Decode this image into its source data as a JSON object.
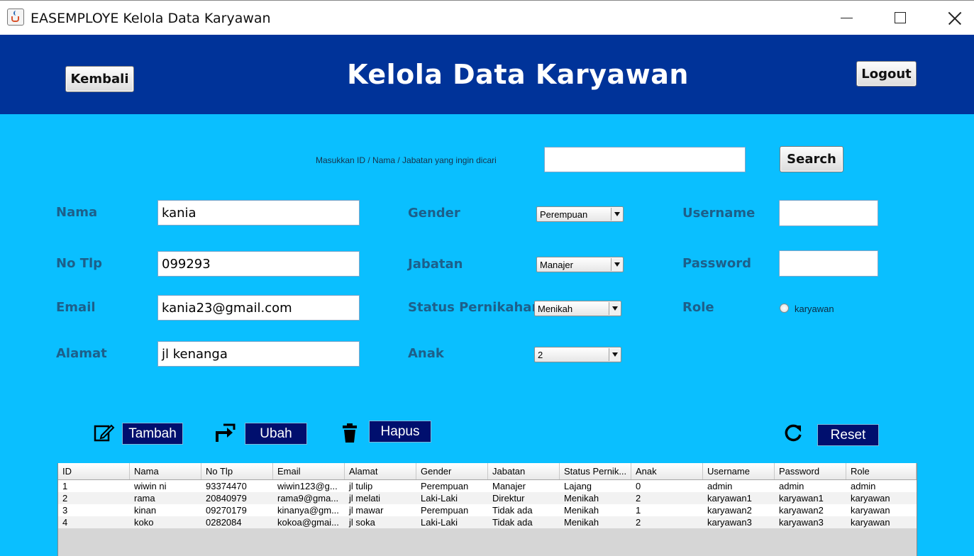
{
  "window": {
    "title": "EASEMPLOYE Kelola Data Karyawan"
  },
  "header": {
    "title": "Kelola Data Karyawan",
    "back_label": "Kembali",
    "logout_label": "Logout"
  },
  "search": {
    "label": "Masukkan ID / Nama / Jabatan yang ingin dicari",
    "value": "",
    "button_label": "Search"
  },
  "form": {
    "nama_label": "Nama",
    "nama_value": "kania",
    "notlp_label": "No Tlp",
    "notlp_value": "099293",
    "email_label": "Email",
    "email_value": "kania23@gmail.com",
    "alamat_label": "Alamat",
    "alamat_value": "jl kenanga",
    "gender_label": "Gender",
    "gender_value": "Perempuan",
    "jabatan_label": "Jabatan",
    "jabatan_value": "Manajer",
    "status_label": "Status Pernikahan",
    "status_value": "Menikah",
    "anak_label": "Anak",
    "anak_value": "2",
    "username_label": "Username",
    "username_value": "",
    "password_label": "Password",
    "password_value": "",
    "role_label": "Role",
    "role_option": "karyawan"
  },
  "actions": {
    "tambah": "Tambah",
    "ubah": "Ubah",
    "hapus": "Hapus",
    "reset": "Reset"
  },
  "table": {
    "columns": [
      "ID",
      "Nama",
      "No Tlp",
      "Email",
      "Alamat",
      "Gender",
      "Jabatan",
      "Status Pernik...",
      "Anak",
      "Username",
      "Password",
      "Role"
    ],
    "rows": [
      [
        "1",
        "wiwin ni",
        "93374470",
        "wiwin123@g...",
        "jl tulip",
        "Perempuan",
        "Manajer",
        "Lajang",
        "0",
        "admin",
        "admin",
        "admin"
      ],
      [
        "2",
        "rama",
        "20840979",
        "rama9@gma...",
        "jl melati",
        "Laki-Laki",
        "Direktur",
        "Menikah",
        "2",
        "karyawan1",
        "karyawan1",
        "karyawan"
      ],
      [
        "3",
        "kinan",
        "09270179",
        "kinanya@gm...",
        "jl mawar",
        "Perempuan",
        "Tidak ada",
        "Menikah",
        "1",
        "karyawan2",
        "karyawan2",
        "karyawan"
      ],
      [
        "4",
        "koko",
        "0282084",
        "kokoa@gmai...",
        "jl soka",
        "Laki-Laki",
        "Tidak ada",
        "Menikah",
        "2",
        "karyawan3",
        "karyawan3",
        "karyawan"
      ]
    ]
  },
  "colors": {
    "header": "#003399",
    "background": "#0abfff",
    "action_button": "#000f6e",
    "label": "#1d5f8a"
  }
}
